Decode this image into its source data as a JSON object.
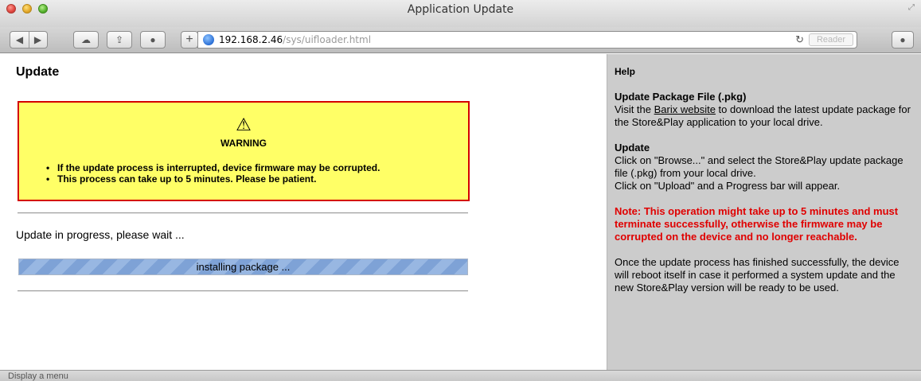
{
  "window": {
    "title": "Application Update"
  },
  "toolbar": {
    "url_host": "192.168.2.46",
    "url_path": "/sys/uifloader.html",
    "reader_label": "Reader",
    "plus_label": "+"
  },
  "main": {
    "title": "Update",
    "warning": {
      "icon": "⚠",
      "title": "WARNING",
      "items": [
        "If the update process is interrupted, device firmware may be corrupted.",
        "This process can take up to 5 minutes. Please be patient."
      ]
    },
    "progress_text": "Update in progress, please wait ...",
    "progress": {
      "label": "installing package ...",
      "fraction": 1.0
    }
  },
  "help": {
    "title": "Help",
    "pkg_heading": "Update Package File (.pkg)",
    "pkg_text_before": "Visit the ",
    "pkg_link": "Barix website",
    "pkg_text_after": " to download the latest update package for the Store&Play application to your local drive.",
    "update_heading": "Update",
    "update_text1": "Click on \"Browse...\" and select the Store&Play update package file (.pkg) from your local drive.",
    "update_text2": "Click on \"Upload\" and a Progress bar will appear.",
    "note": "Note: This operation might take up to 5 minutes and must terminate successfully, otherwise the firmware may be corrupted on the device and no longer reachable.",
    "final_text": "Once the update process has finished successfully, the device will reboot itself in case it performed a system update and the new Store&Play version will be ready to be used."
  },
  "statusbar": {
    "text": "Display a menu"
  },
  "colors": {
    "warning_bg": "#ffff66",
    "warning_border": "#d40000",
    "note": "#e00000",
    "help_bg": "#cccccc"
  }
}
